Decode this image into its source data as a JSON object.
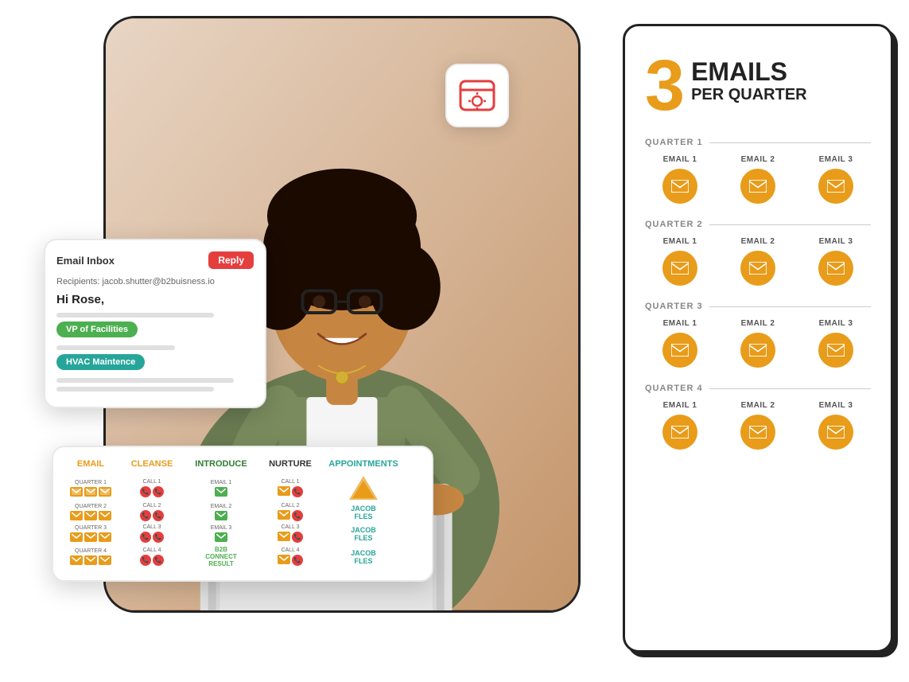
{
  "gear_icon": "⚙",
  "email_inbox": {
    "title": "Email Inbox",
    "reply_label": "Reply",
    "recipients_text": "Recipients: jacob.shutter@b2buisness.io",
    "greeting": "Hi Rose,",
    "tags": [
      "VP of Facilities",
      "HVAC Maintence"
    ]
  },
  "spreadsheet": {
    "columns": [
      "EMAIL",
      "CLEANSE",
      "INTRODUCE",
      "NURTURE",
      "APPOINTMENTS"
    ],
    "rows": [
      "QUARTER 1",
      "QUARTER 2",
      "QUARTER 3",
      "QUARTER 4"
    ]
  },
  "right_panel": {
    "big_number": "3",
    "emails_word": "EMAILS",
    "per_quarter": "PER QUARTER",
    "quarters": [
      {
        "label": "QUARTER 1",
        "emails": [
          "EMAIL 1",
          "EMAIL 2",
          "EMAIL 3"
        ]
      },
      {
        "label": "QUARTER 2",
        "emails": [
          "EMAIL 1",
          "EMAIL 2",
          "EMAIL 3"
        ]
      },
      {
        "label": "QUARTER 3",
        "emails": [
          "EMAIL 1",
          "EMAIL 2",
          "EMAIL 3"
        ]
      },
      {
        "label": "QUARTER 4",
        "emails": [
          "EMAIL 1",
          "EMAIL 2",
          "EMAIL 3"
        ]
      }
    ]
  }
}
